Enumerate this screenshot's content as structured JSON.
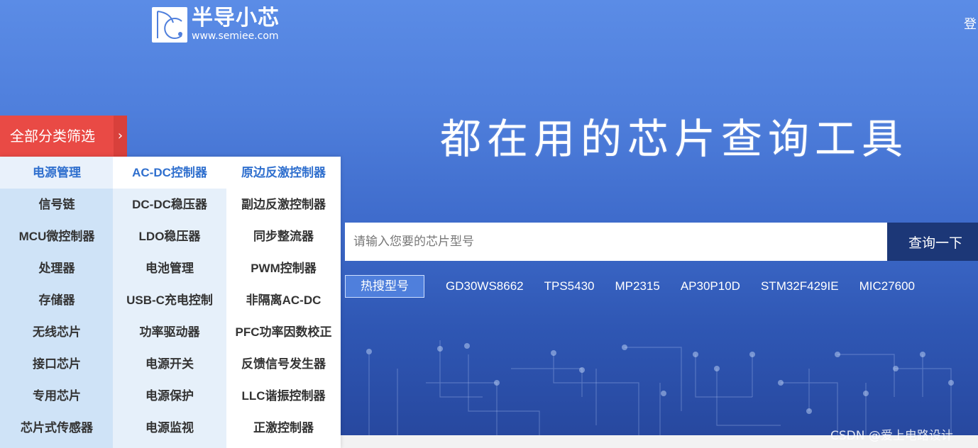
{
  "header": {
    "logo_name": "半导小芯",
    "logo_url": "www.semiee.com",
    "login_label": "登"
  },
  "hero": {
    "slogan": "都在用的芯片查询工具"
  },
  "search": {
    "placeholder": "请输入您要的芯片型号",
    "value": "",
    "button_label": "查询一下"
  },
  "hot": {
    "label": "热搜型号",
    "items": [
      "GD30WS8662",
      "TPS5430",
      "MP2315",
      "AP30P10D",
      "STM32F429IE",
      "MIC27600"
    ]
  },
  "category": {
    "header_label": "全部分类筛选",
    "arrow": "›",
    "col1": [
      "电源管理",
      "信号链",
      "MCU微控制器",
      "处理器",
      "存储器",
      "无线芯片",
      "接口芯片",
      "专用芯片",
      "芯片式传感器"
    ],
    "col2": [
      "AC-DC控制器",
      "DC-DC稳压器",
      "LDO稳压器",
      "电池管理",
      "USB-C充电控制",
      "功率驱动器",
      "电源开关",
      "电源保护",
      "电源监视"
    ],
    "col3": [
      "原边反激控制器",
      "副边反激控制器",
      "同步整流器",
      "PWM控制器",
      "非隔离AC-DC",
      "PFC功率因数校正",
      "反馈信号发生器",
      "LLC谐振控制器",
      "正激控制器"
    ]
  },
  "watermark": "CSDN @爱上电路设计",
  "colors": {
    "accent_red": "#e94a45",
    "button_navy": "#1c3777",
    "link_blue": "#2f6fce",
    "hero_top": "#5b8ce6",
    "hero_bottom": "#27489f"
  }
}
